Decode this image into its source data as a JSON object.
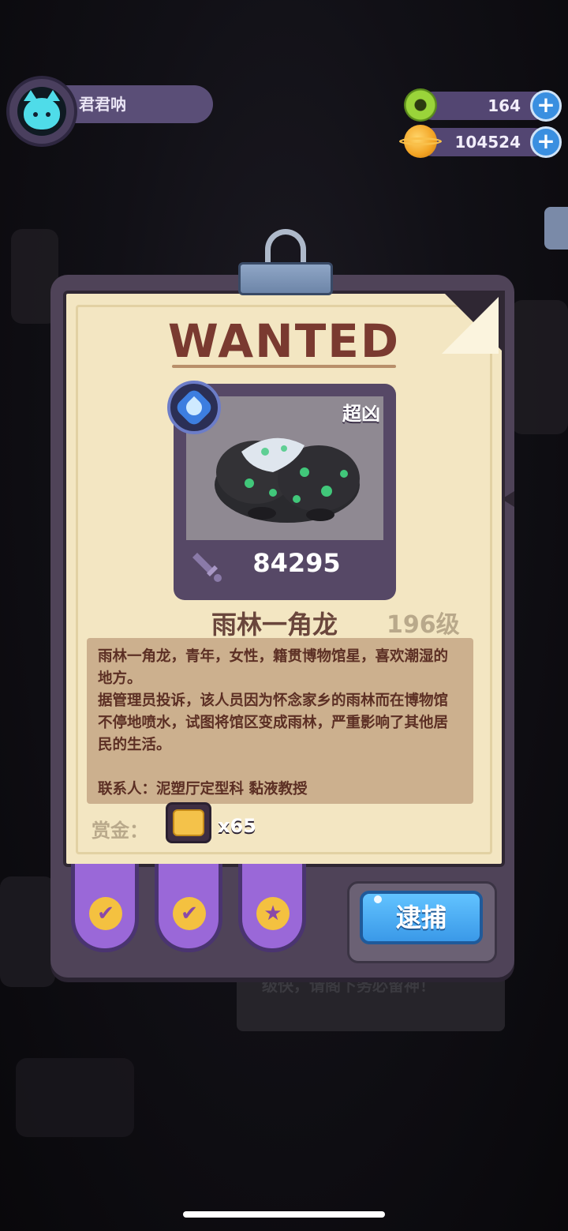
{
  "player": {
    "name": "君君呐"
  },
  "currencies": [
    {
      "icon": "donut-icon",
      "value": "164"
    },
    {
      "icon": "planet-icon",
      "value": "104524"
    }
  ],
  "poster": {
    "title": "WANTED",
    "rank": "超凶",
    "element_icon": "water-drop-icon",
    "power": "84295",
    "monster_name": "雨林一角龙",
    "monster_level": "196级",
    "description": [
      "雨林一角龙，青年，女性，籍贯博物馆星，喜欢潮湿的地方。",
      "据管理员投诉，该人员因为怀念家乡的雨林而在博物馆不停地喷水，试图将馆区变成雨林，严重影响了其他居民的生活。",
      "",
      "联系人：泥塑厅定型科 黏液教授"
    ],
    "reward_label": "赏金：",
    "reward_icon": "bread-ticket-icon",
    "reward_count": "x65"
  },
  "tasks": [
    {
      "icon": "check-icon",
      "glyph": "✔"
    },
    {
      "icon": "check-icon",
      "glyph": "✔"
    },
    {
      "icon": "star-icon",
      "glyph": "★"
    }
  ],
  "actions": {
    "arrest_label": "逮捕"
  },
  "background": {
    "faint_banner_text": "级快，请阁下务必留神！"
  }
}
